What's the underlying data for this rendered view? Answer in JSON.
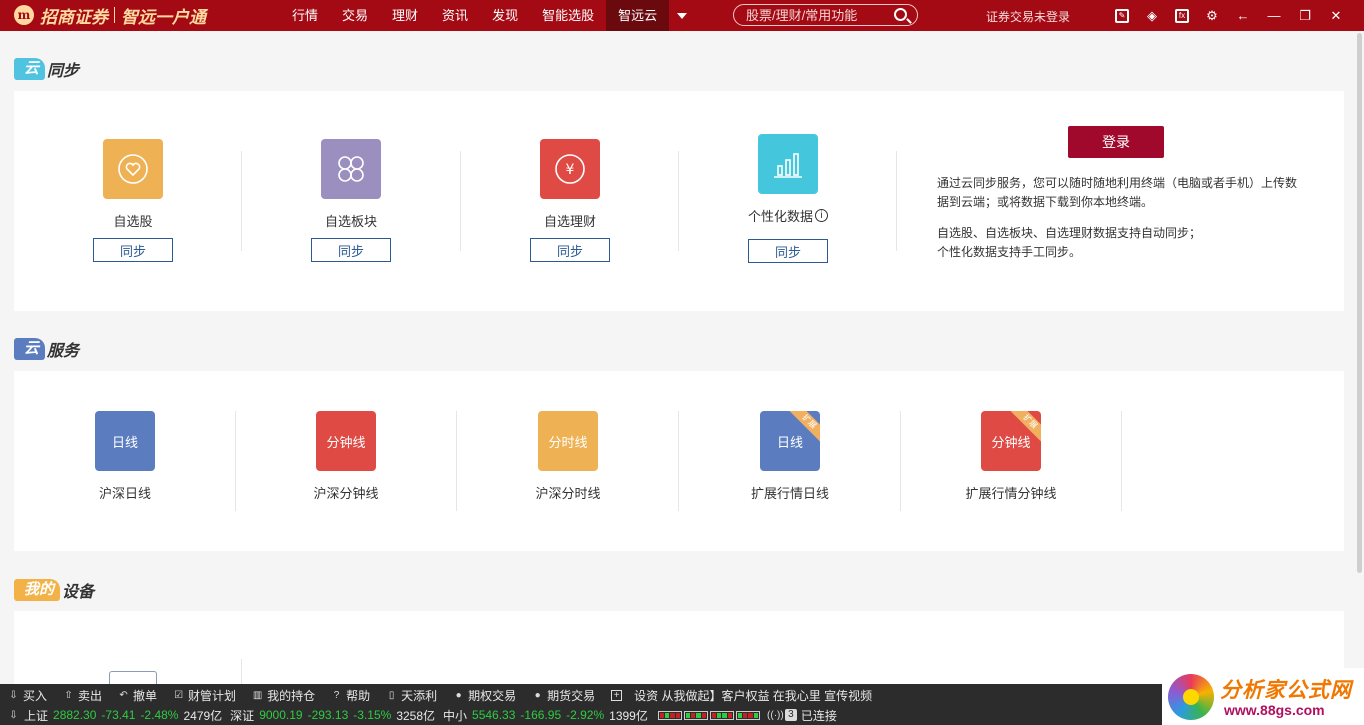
{
  "app": {
    "logo_text": "招商证券",
    "logo_sub": "智远一户通",
    "logo_mark": "m",
    "login_status": "证券交易未登录"
  },
  "nav": {
    "items": [
      "行情",
      "交易",
      "理财",
      "资讯",
      "发现",
      "智能选股",
      "智远云"
    ],
    "active": "智远云"
  },
  "search": {
    "placeholder": "股票/理财/常用功能"
  },
  "window_icons": [
    "edit-icon",
    "box-icon",
    "fx-icon",
    "gear-icon",
    "back-arrow-icon",
    "minimize-icon",
    "restore-icon",
    "close-icon"
  ],
  "sync": {
    "tag": "云",
    "title": "同步",
    "tag_color": "#4fc3e0",
    "cards": [
      {
        "label": "自选股",
        "button": "同步",
        "color": "#eeb255",
        "icon": "heart-icon"
      },
      {
        "label": "自选板块",
        "button": "同步",
        "color": "#9b8fc0",
        "icon": "blocks-icon"
      },
      {
        "label": "自选理财",
        "button": "同步",
        "color": "#df4a44",
        "icon": "yuan-icon",
        "glyph": "¥"
      },
      {
        "label": "个性化数据",
        "button": "同步",
        "color": "#44c6dc",
        "icon": "bar-chart-icon",
        "info": "i"
      }
    ],
    "login_button": "登录",
    "desc1": "通过云同步服务，您可以随时随地利用终端（电脑或者手机）上传数据到云端；或将数据下载到你本地终端。",
    "desc2": "自选股、自选板块、自选理财数据支持自动同步；",
    "desc3": "个性化数据支持手工同步。"
  },
  "service": {
    "tag": "云",
    "title": "服务",
    "tag_color": "#5b7dc0",
    "cards": [
      {
        "label": "沪深日线",
        "icon_text": "日线",
        "color": "#5b7dc0"
      },
      {
        "label": "沪深分钟线",
        "icon_text": "分钟线",
        "color": "#df4a44"
      },
      {
        "label": "沪深分时线",
        "icon_text": "分时线",
        "color": "#eeb255"
      },
      {
        "label": "扩展行情日线",
        "icon_text": "日线",
        "color": "#5b7dc0",
        "ribbon": "扩展"
      },
      {
        "label": "扩展行情分钟线",
        "icon_text": "分钟线",
        "color": "#df4a44",
        "ribbon": "扩展"
      }
    ]
  },
  "devices": {
    "tag": "我的",
    "title": "设备",
    "tag_color": "#f3b247"
  },
  "bottom": {
    "actions": [
      {
        "label": "买入",
        "icon": "download-icon",
        "glyph": "⇩"
      },
      {
        "label": "卖出",
        "icon": "upload-icon",
        "glyph": "⇧"
      },
      {
        "label": "撤单",
        "icon": "undo-icon",
        "glyph": "↶"
      },
      {
        "label": "财管计划",
        "icon": "checklist-icon",
        "glyph": "☑"
      },
      {
        "label": "我的持仓",
        "icon": "building-icon",
        "glyph": "▥"
      },
      {
        "label": "帮助",
        "icon": "help-icon",
        "glyph": "?"
      },
      {
        "label": "天添利",
        "icon": "phone-icon",
        "glyph": "▯"
      },
      {
        "label": "期权交易",
        "icon": "option-icon",
        "glyph": "●"
      },
      {
        "label": "期货交易",
        "icon": "futures-icon",
        "glyph": "●"
      }
    ],
    "add_icon": "+",
    "ticker": "设资 从我做起】客户权益 在我心里 宣传视频",
    "quotes": [
      {
        "name": "上证",
        "price": "2882.30",
        "change": "-73.41",
        "pct": "-2.48%",
        "volume": "2479亿"
      },
      {
        "name": "深证",
        "price": "9000.19",
        "change": "-293.13",
        "pct": "-3.15%",
        "volume": "3258亿"
      },
      {
        "name": "中小",
        "price": "5546.33",
        "change": "-166.95",
        "pct": "-2.92%",
        "volume": "1399亿"
      }
    ],
    "connection_count": "3",
    "connection_label": "已连接"
  },
  "watermark": {
    "title": "分析家公式网",
    "url": "www.88gs.com"
  }
}
